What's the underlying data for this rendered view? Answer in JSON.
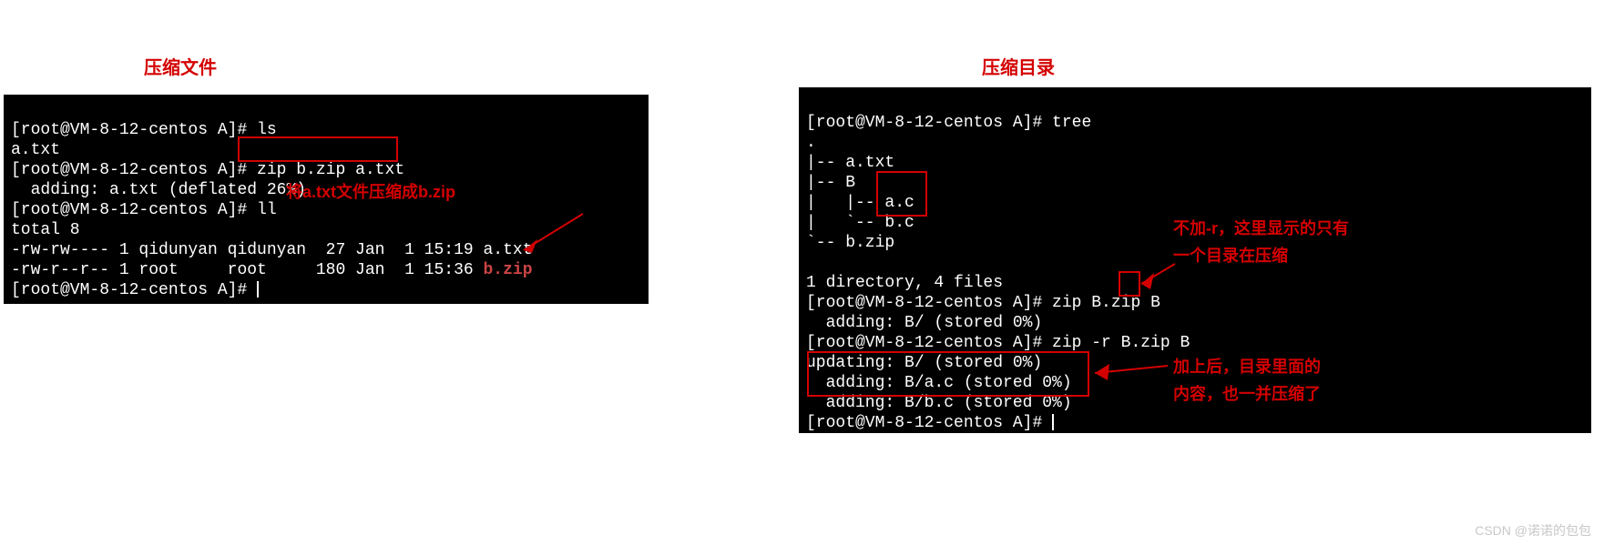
{
  "titles": {
    "left": "压缩文件",
    "right": "压缩目录"
  },
  "left_terminal": {
    "l1": "[root@VM-8-12-centos A]# ls",
    "l2": "a.txt",
    "l3_pre": "[root@VM-8-12-centos A]# ",
    "l3_cmd": "zip b.zip a.txt",
    "l4": "  adding: a.txt (deflated 26%)",
    "l5": "[root@VM-8-12-centos A]# ll",
    "l6": "total 8",
    "l7": "-rw-rw---- 1 qidunyan qidunyan  27 Jan  1 15:19 a.txt",
    "l8_pre": "-rw-r--r-- 1 root     root     180 Jan  1 15:36 ",
    "l8_file": "b.zip",
    "l9": "[root@VM-8-12-centos A]# "
  },
  "left_annotation": "将a.txt文件压缩成b.zip",
  "right_terminal": {
    "r1": "[root@VM-8-12-centos A]# tree",
    "r2": ".",
    "r3": "|-- a.txt",
    "r4": "|-- B",
    "r5_pre": "|   |-- ",
    "r5_file": "a.c",
    "r6_pre": "|   `-- ",
    "r6_file": "b.c",
    "r7": "`-- b.zip",
    "r8": "",
    "r9": "1 directory, 4 files",
    "r10_pre": "[root@VM-8-12-centos A]# zip B.zip ",
    "r10_arg": "B",
    "r11": "  adding: B/ (stored 0%)",
    "r12": "[root@VM-8-12-centos A]# zip -r B.zip B",
    "r13": "updating: B/ (stored 0%)",
    "r14": "  adding: B/a.c (stored 0%)",
    "r15": "  adding: B/b.c (stored 0%)",
    "r16": "[root@VM-8-12-centos A]# "
  },
  "right_annotation1_l1": "不加-r，这里显示的只有",
  "right_annotation1_l2": "一个目录在压缩",
  "right_annotation2_l1": "加上后，目录里面的",
  "right_annotation2_l2": "内容，也一并压缩了",
  "watermark": "CSDN @诺诺的包包"
}
